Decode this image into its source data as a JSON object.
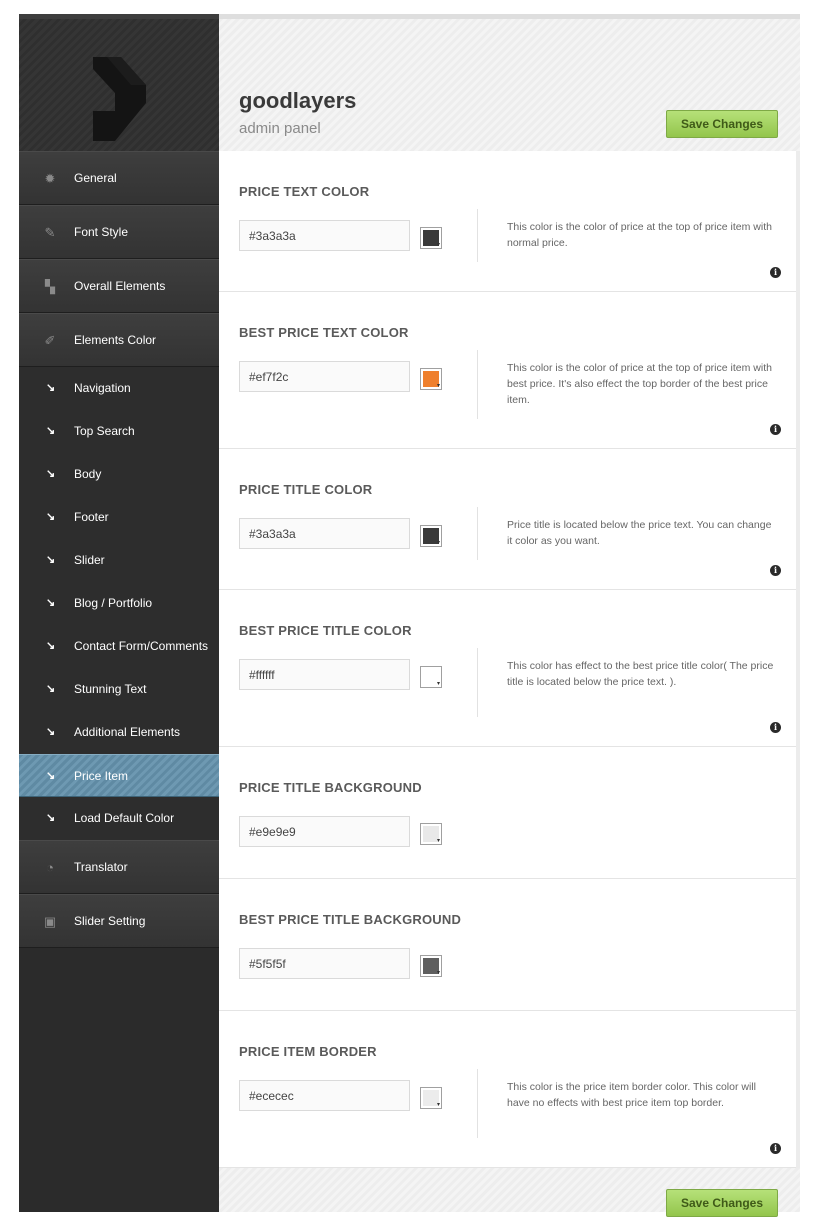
{
  "brand": {
    "title": "goodlayers",
    "subtitle": "admin panel"
  },
  "save_label": "Save Changes",
  "sidebar": {
    "main_top": [
      {
        "label": "General",
        "icon": "gear-icon"
      },
      {
        "label": "Font Style",
        "icon": "pencil-icon"
      },
      {
        "label": "Overall Elements",
        "icon": "layout-icon"
      },
      {
        "label": "Elements Color",
        "icon": "brush-icon"
      }
    ],
    "sub_items": [
      {
        "label": "Navigation"
      },
      {
        "label": "Top Search"
      },
      {
        "label": "Body"
      },
      {
        "label": "Footer"
      },
      {
        "label": "Slider"
      },
      {
        "label": "Blog / Portfolio"
      },
      {
        "label": "Contact Form/Comments"
      },
      {
        "label": "Stunning Text"
      },
      {
        "label": "Additional Elements"
      },
      {
        "label": "Price Item",
        "active": true
      },
      {
        "label": "Load Default Color"
      }
    ],
    "main_bottom": [
      {
        "label": "Translator",
        "icon": "pacman-icon"
      },
      {
        "label": "Slider Setting",
        "icon": "slider-icon"
      }
    ]
  },
  "sections": [
    {
      "title": "PRICE TEXT COLOR",
      "value": "#3a3a3a",
      "swatch": "#3a3a3a",
      "description": "This color is the color of price at the top of price item with normal price."
    },
    {
      "title": "BEST PRICE TEXT COLOR",
      "value": "#ef7f2c",
      "swatch": "#ef7f2c",
      "description": "This color is the color of price at the top of price item with best price. It's also effect the top border of the best price item."
    },
    {
      "title": "PRICE TITLE COLOR",
      "value": "#3a3a3a",
      "swatch": "#3a3a3a",
      "description": "Price title is located below the price text. You can change it color as you want."
    },
    {
      "title": "BEST PRICE TITLE COLOR",
      "value": "#ffffff",
      "swatch": "#ffffff",
      "description": "This color has effect to the best price title color( The price title is located below the price text. )."
    },
    {
      "title": "PRICE TITLE BACKGROUND",
      "value": "#e9e9e9",
      "swatch": "#e9e9e9",
      "description": ""
    },
    {
      "title": "BEST PRICE TITLE BACKGROUND",
      "value": "#5f5f5f",
      "swatch": "#5f5f5f",
      "description": ""
    },
    {
      "title": "PRICE ITEM BORDER",
      "value": "#ececec",
      "swatch": "#ececec",
      "description": "This color is the price item border color. This color will have no effects with best price item top border."
    }
  ]
}
